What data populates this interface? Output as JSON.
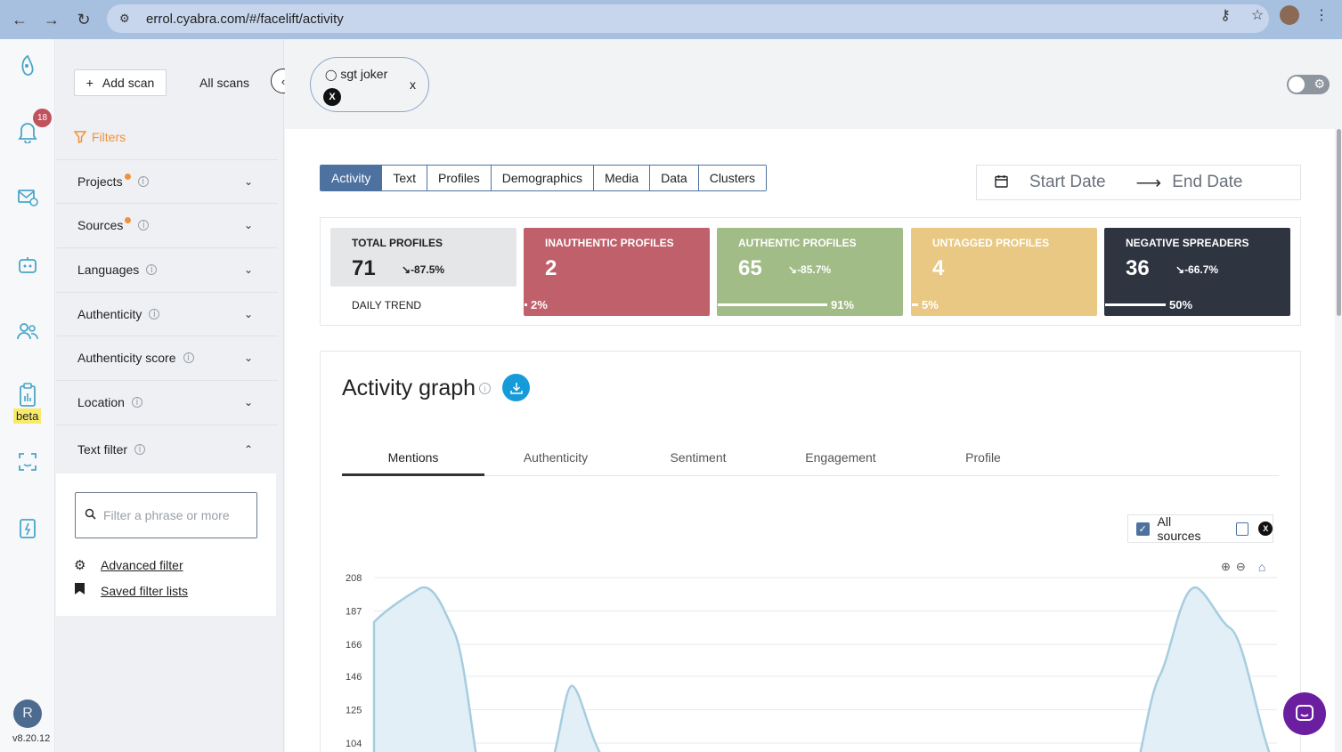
{
  "browser": {
    "url": "errol.cyabra.com/#/facelift/activity"
  },
  "rail": {
    "notifications_count": "18",
    "beta_label": "beta",
    "user_initial": "R",
    "version": "v8.20.12"
  },
  "panel": {
    "add_scan": "Add scan",
    "all_scans": "All scans",
    "filters_title": "Filters",
    "filters": [
      {
        "label": "Projects",
        "dot": true,
        "open": false
      },
      {
        "label": "Sources",
        "dot": true,
        "open": false
      },
      {
        "label": "Languages",
        "dot": false,
        "open": false
      },
      {
        "label": "Authenticity",
        "dot": false,
        "open": false
      },
      {
        "label": "Authenticity score",
        "dot": false,
        "open": false
      },
      {
        "label": "Location",
        "dot": false,
        "open": false
      },
      {
        "label": "Text filter",
        "dot": false,
        "open": true
      }
    ],
    "text_filter": {
      "placeholder": "Filter a phrase or more",
      "advanced": "Advanced filter",
      "saved": "Saved filter lists"
    }
  },
  "header": {
    "scan_name": "sgt joker",
    "scan_close": "x"
  },
  "main": {
    "tabs": [
      "Activity",
      "Text",
      "Profiles",
      "Demographics",
      "Media",
      "Data",
      "Clusters"
    ],
    "active_tab": "Activity",
    "start_date": "Start Date",
    "end_date": "End Date",
    "stats": {
      "total": {
        "title": "TOTAL PROFILES",
        "value": "71",
        "trend": "-87.5%",
        "daily": "DAILY TREND"
      },
      "inauthentic": {
        "title": "INAUTHENTIC PROFILES",
        "value": "2",
        "pct": "2%",
        "fraction": 0.02,
        "color": "#c0606a"
      },
      "authentic": {
        "title": "AUTHENTIC PROFILES",
        "value": "65",
        "trend": "-85.7%",
        "pct": "91%",
        "fraction": 0.91,
        "color": "#a2bc87"
      },
      "untagged": {
        "title": "UNTAGGED PROFILES",
        "value": "4",
        "pct": "5%",
        "fraction": 0.05,
        "color": "#e9c884"
      },
      "negative": {
        "title": "NEGATIVE SPREADERS",
        "value": "36",
        "trend": "-66.7%",
        "pct": "50%",
        "fraction": 0.5,
        "color": "#2e3440"
      }
    },
    "graph": {
      "title": "Activity graph",
      "tabs": [
        "Mentions",
        "Authenticity",
        "Sentiment",
        "Engagement",
        "Profile"
      ],
      "active_tab": "Mentions",
      "all_sources": "All sources"
    }
  },
  "chart_data": {
    "type": "area",
    "yticks": [
      208,
      187,
      166,
      146,
      125,
      104
    ],
    "ylim": [
      104,
      208
    ],
    "grid": true,
    "color": "#a6cde0"
  }
}
